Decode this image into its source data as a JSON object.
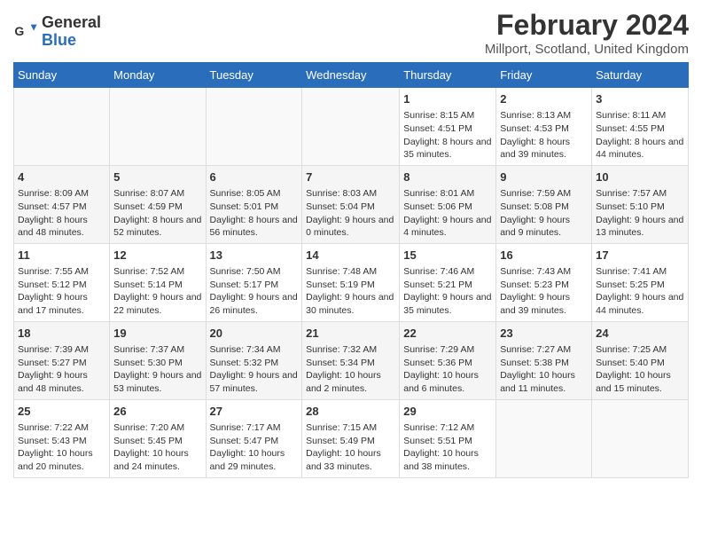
{
  "header": {
    "logo_general": "General",
    "logo_blue": "Blue",
    "month_title": "February 2024",
    "location": "Millport, Scotland, United Kingdom"
  },
  "days_of_week": [
    "Sunday",
    "Monday",
    "Tuesday",
    "Wednesday",
    "Thursday",
    "Friday",
    "Saturday"
  ],
  "weeks": [
    [
      {
        "num": "",
        "sunrise": "",
        "sunset": "",
        "daylight": ""
      },
      {
        "num": "",
        "sunrise": "",
        "sunset": "",
        "daylight": ""
      },
      {
        "num": "",
        "sunrise": "",
        "sunset": "",
        "daylight": ""
      },
      {
        "num": "",
        "sunrise": "",
        "sunset": "",
        "daylight": ""
      },
      {
        "num": "1",
        "sunrise": "Sunrise: 8:15 AM",
        "sunset": "Sunset: 4:51 PM",
        "daylight": "Daylight: 8 hours and 35 minutes."
      },
      {
        "num": "2",
        "sunrise": "Sunrise: 8:13 AM",
        "sunset": "Sunset: 4:53 PM",
        "daylight": "Daylight: 8 hours and 39 minutes."
      },
      {
        "num": "3",
        "sunrise": "Sunrise: 8:11 AM",
        "sunset": "Sunset: 4:55 PM",
        "daylight": "Daylight: 8 hours and 44 minutes."
      }
    ],
    [
      {
        "num": "4",
        "sunrise": "Sunrise: 8:09 AM",
        "sunset": "Sunset: 4:57 PM",
        "daylight": "Daylight: 8 hours and 48 minutes."
      },
      {
        "num": "5",
        "sunrise": "Sunrise: 8:07 AM",
        "sunset": "Sunset: 4:59 PM",
        "daylight": "Daylight: 8 hours and 52 minutes."
      },
      {
        "num": "6",
        "sunrise": "Sunrise: 8:05 AM",
        "sunset": "Sunset: 5:01 PM",
        "daylight": "Daylight: 8 hours and 56 minutes."
      },
      {
        "num": "7",
        "sunrise": "Sunrise: 8:03 AM",
        "sunset": "Sunset: 5:04 PM",
        "daylight": "Daylight: 9 hours and 0 minutes."
      },
      {
        "num": "8",
        "sunrise": "Sunrise: 8:01 AM",
        "sunset": "Sunset: 5:06 PM",
        "daylight": "Daylight: 9 hours and 4 minutes."
      },
      {
        "num": "9",
        "sunrise": "Sunrise: 7:59 AM",
        "sunset": "Sunset: 5:08 PM",
        "daylight": "Daylight: 9 hours and 9 minutes."
      },
      {
        "num": "10",
        "sunrise": "Sunrise: 7:57 AM",
        "sunset": "Sunset: 5:10 PM",
        "daylight": "Daylight: 9 hours and 13 minutes."
      }
    ],
    [
      {
        "num": "11",
        "sunrise": "Sunrise: 7:55 AM",
        "sunset": "Sunset: 5:12 PM",
        "daylight": "Daylight: 9 hours and 17 minutes."
      },
      {
        "num": "12",
        "sunrise": "Sunrise: 7:52 AM",
        "sunset": "Sunset: 5:14 PM",
        "daylight": "Daylight: 9 hours and 22 minutes."
      },
      {
        "num": "13",
        "sunrise": "Sunrise: 7:50 AM",
        "sunset": "Sunset: 5:17 PM",
        "daylight": "Daylight: 9 hours and 26 minutes."
      },
      {
        "num": "14",
        "sunrise": "Sunrise: 7:48 AM",
        "sunset": "Sunset: 5:19 PM",
        "daylight": "Daylight: 9 hours and 30 minutes."
      },
      {
        "num": "15",
        "sunrise": "Sunrise: 7:46 AM",
        "sunset": "Sunset: 5:21 PM",
        "daylight": "Daylight: 9 hours and 35 minutes."
      },
      {
        "num": "16",
        "sunrise": "Sunrise: 7:43 AM",
        "sunset": "Sunset: 5:23 PM",
        "daylight": "Daylight: 9 hours and 39 minutes."
      },
      {
        "num": "17",
        "sunrise": "Sunrise: 7:41 AM",
        "sunset": "Sunset: 5:25 PM",
        "daylight": "Daylight: 9 hours and 44 minutes."
      }
    ],
    [
      {
        "num": "18",
        "sunrise": "Sunrise: 7:39 AM",
        "sunset": "Sunset: 5:27 PM",
        "daylight": "Daylight: 9 hours and 48 minutes."
      },
      {
        "num": "19",
        "sunrise": "Sunrise: 7:37 AM",
        "sunset": "Sunset: 5:30 PM",
        "daylight": "Daylight: 9 hours and 53 minutes."
      },
      {
        "num": "20",
        "sunrise": "Sunrise: 7:34 AM",
        "sunset": "Sunset: 5:32 PM",
        "daylight": "Daylight: 9 hours and 57 minutes."
      },
      {
        "num": "21",
        "sunrise": "Sunrise: 7:32 AM",
        "sunset": "Sunset: 5:34 PM",
        "daylight": "Daylight: 10 hours and 2 minutes."
      },
      {
        "num": "22",
        "sunrise": "Sunrise: 7:29 AM",
        "sunset": "Sunset: 5:36 PM",
        "daylight": "Daylight: 10 hours and 6 minutes."
      },
      {
        "num": "23",
        "sunrise": "Sunrise: 7:27 AM",
        "sunset": "Sunset: 5:38 PM",
        "daylight": "Daylight: 10 hours and 11 minutes."
      },
      {
        "num": "24",
        "sunrise": "Sunrise: 7:25 AM",
        "sunset": "Sunset: 5:40 PM",
        "daylight": "Daylight: 10 hours and 15 minutes."
      }
    ],
    [
      {
        "num": "25",
        "sunrise": "Sunrise: 7:22 AM",
        "sunset": "Sunset: 5:43 PM",
        "daylight": "Daylight: 10 hours and 20 minutes."
      },
      {
        "num": "26",
        "sunrise": "Sunrise: 7:20 AM",
        "sunset": "Sunset: 5:45 PM",
        "daylight": "Daylight: 10 hours and 24 minutes."
      },
      {
        "num": "27",
        "sunrise": "Sunrise: 7:17 AM",
        "sunset": "Sunset: 5:47 PM",
        "daylight": "Daylight: 10 hours and 29 minutes."
      },
      {
        "num": "28",
        "sunrise": "Sunrise: 7:15 AM",
        "sunset": "Sunset: 5:49 PM",
        "daylight": "Daylight: 10 hours and 33 minutes."
      },
      {
        "num": "29",
        "sunrise": "Sunrise: 7:12 AM",
        "sunset": "Sunset: 5:51 PM",
        "daylight": "Daylight: 10 hours and 38 minutes."
      },
      {
        "num": "",
        "sunrise": "",
        "sunset": "",
        "daylight": ""
      },
      {
        "num": "",
        "sunrise": "",
        "sunset": "",
        "daylight": ""
      }
    ]
  ]
}
